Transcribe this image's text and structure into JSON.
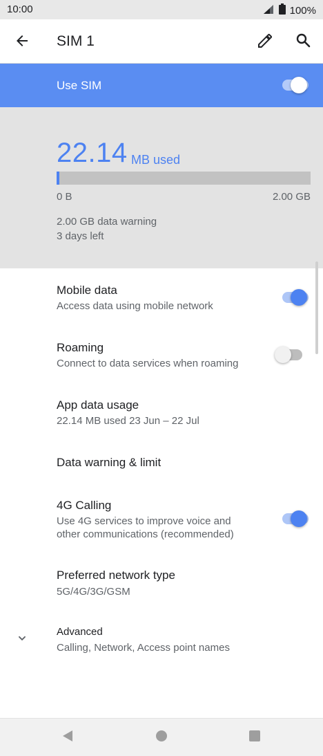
{
  "status_bar": {
    "time": "10:00",
    "battery": "100%",
    "icons": [
      "signal-icon",
      "battery-icon"
    ]
  },
  "app_bar": {
    "title": "SIM 1",
    "icons": [
      "back-arrow-icon",
      "edit-pencil-icon",
      "search-icon"
    ]
  },
  "use_sim": {
    "label": "Use SIM",
    "enabled": true
  },
  "usage": {
    "used_value": "22.14",
    "used_unit": "MB used",
    "bar_min": "0 B",
    "bar_max": "2.00 GB",
    "progress_fraction": 0.011,
    "warning": "2.00 GB data warning",
    "days_left": "3 days left"
  },
  "settings": {
    "mobile_data": {
      "title": "Mobile data",
      "subtitle": "Access data using mobile network",
      "enabled": true
    },
    "roaming": {
      "title": "Roaming",
      "subtitle": "Connect to data services when roaming",
      "enabled": false
    },
    "app_data_usage": {
      "title": "App data usage",
      "subtitle": "22.14 MB used 23 Jun – 22 Jul"
    },
    "data_warning": {
      "title": "Data warning & limit"
    },
    "calling_4g": {
      "title": "4G Calling",
      "subtitle_line1": "Use 4G services to improve voice and",
      "subtitle_line2": "other communications (recommended)",
      "enabled": true
    },
    "preferred_network": {
      "title": "Preferred network type",
      "subtitle": "5G/4G/3G/GSM"
    },
    "advanced": {
      "title": "Advanced",
      "subtitle": "Calling, Network, Access point names"
    }
  },
  "colors": {
    "accent": "#4d82f1",
    "header_blue": "#5a8df2",
    "usage_bg": "#e3e3e3"
  },
  "nav_bar": {
    "icons": [
      "back-triangle-icon",
      "home-circle-icon",
      "recents-square-icon"
    ]
  }
}
